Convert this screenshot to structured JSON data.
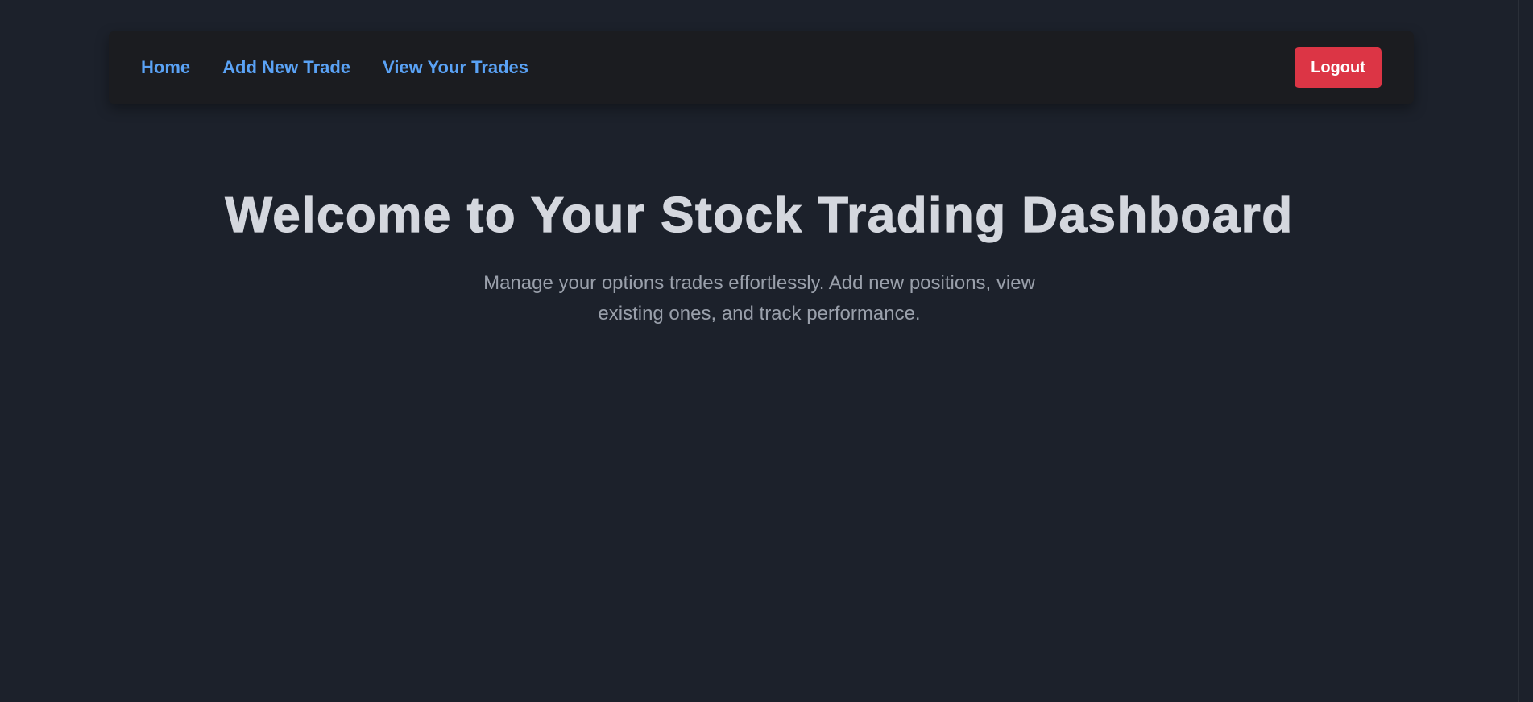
{
  "nav": {
    "links": [
      {
        "label": "Home"
      },
      {
        "label": "Add New Trade"
      },
      {
        "label": "View Your Trades"
      }
    ],
    "logout_label": "Logout"
  },
  "hero": {
    "title": "Welcome to Your Stock Trading Dashboard",
    "subtitle": "Manage your options trades effortlessly. Add new positions, view existing ones, and track performance."
  },
  "colors": {
    "background": "#1c212b",
    "navbar": "#1b1c20",
    "link": "#5aa2f5",
    "logout": "#dc3545",
    "title": "#d4d7de",
    "subtitle": "#9aa0ab"
  }
}
